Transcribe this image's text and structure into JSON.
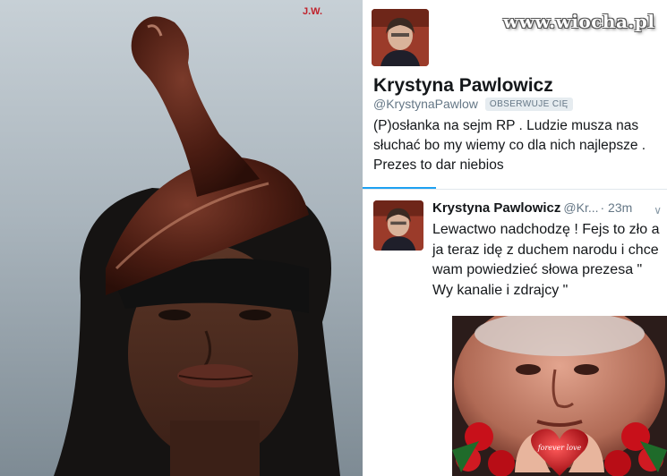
{
  "photo_left": {
    "signature": "J.W.",
    "description_icon": "hat-photo"
  },
  "watermark": "www.wiocha.pl",
  "tweet_profile": {
    "name": "Krystyna Pawlowicz",
    "handle": "@KrystynaPawlow",
    "follows_badge": "OBSERWUJE CIĘ",
    "bio": "(P)osłanka na sejm RP . Ludzie musza nas słuchać bo my wiemy co dla nich najlepsze . Prezes to dar niebios",
    "accent_color": "#1da1f2"
  },
  "tweet_post": {
    "name": "Krystyna Pawlowicz",
    "handle": "@Kr...",
    "time": "· 23m",
    "text": "Lewactwo nadchodzę ! Fejs to zło a ja teraz idę z duchem narodu i chce wam powiedzieć słowa prezesa \" Wy kanalie i zdrajcy \"",
    "menu_icon": "chevron-down-icon"
  },
  "photo_right": {
    "heart_text": "forever love"
  }
}
